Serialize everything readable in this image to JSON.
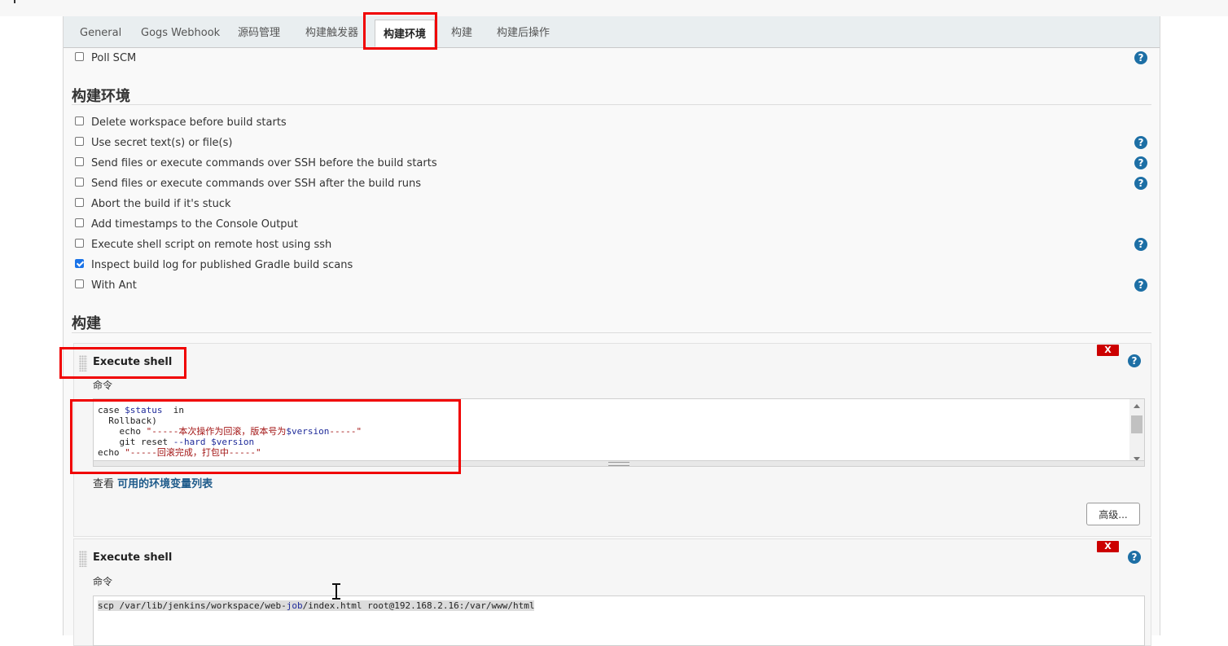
{
  "tabs": [
    "General",
    "Gogs Webhook",
    "源码管理",
    "构建触发器",
    "构建环境",
    "构建",
    "构建后操作"
  ],
  "active_tab": "构建环境",
  "poll_scm": {
    "label": "Poll SCM",
    "checked": false
  },
  "build_env": {
    "title": "构建环境",
    "options": [
      {
        "label": "Delete workspace before build starts",
        "checked": false,
        "help": false
      },
      {
        "label": "Use secret text(s) or file(s)",
        "checked": false,
        "help": true
      },
      {
        "label": "Send files or execute commands over SSH before the build starts",
        "checked": false,
        "help": true
      },
      {
        "label": "Send files or execute commands over SSH after the build runs",
        "checked": false,
        "help": true
      },
      {
        "label": "Abort the build if it's stuck",
        "checked": false,
        "help": false
      },
      {
        "label": "Add timestamps to the Console Output",
        "checked": false,
        "help": false
      },
      {
        "label": "Execute shell script on remote host using ssh",
        "checked": false,
        "help": true
      },
      {
        "label": "Inspect build log for published Gradle build scans",
        "checked": true,
        "help": false
      },
      {
        "label": "With Ant",
        "checked": false,
        "help": true
      }
    ]
  },
  "build": {
    "title": "构建",
    "steps": [
      {
        "title": "Execute shell",
        "command_label": "命令",
        "delete_label": "X",
        "code": {
          "l1_kw": "case ",
          "l1_var": "$status",
          "l1_rest": "  in",
          "l2": "  Rollback)",
          "l3_kw": "    echo ",
          "l3_str": "\"-----本次操作为回滚，版本号为",
          "l3_var": "$version",
          "l3_str2": "-----\"",
          "l4_kw": "    git reset ",
          "l4_flag": "--hard",
          "l4_sp": " ",
          "l4_var": "$version",
          "l5_kw": "echo ",
          "l5_str": "\"-----回滚完成，打包中-----\"",
          "l6": "    ;;"
        },
        "env_prefix": "查看 ",
        "env_link": "可用的环境变量列表",
        "advanced_label": "高级..."
      },
      {
        "title": "Execute shell",
        "command_label": "命令",
        "delete_label": "X",
        "code": {
          "l1_a": "scp /var/lib/jenkins/workspace/web-",
          "l1_b": "job",
          "l1_c": "/index.html root@192.168.2.16:/var/www/html"
        }
      }
    ]
  },
  "help_glyph": "?",
  "accent_colors": {
    "help": "#1d6fa5",
    "delete": "#cc0000",
    "annotation": "#f00000",
    "link": "#1d5a8a"
  }
}
